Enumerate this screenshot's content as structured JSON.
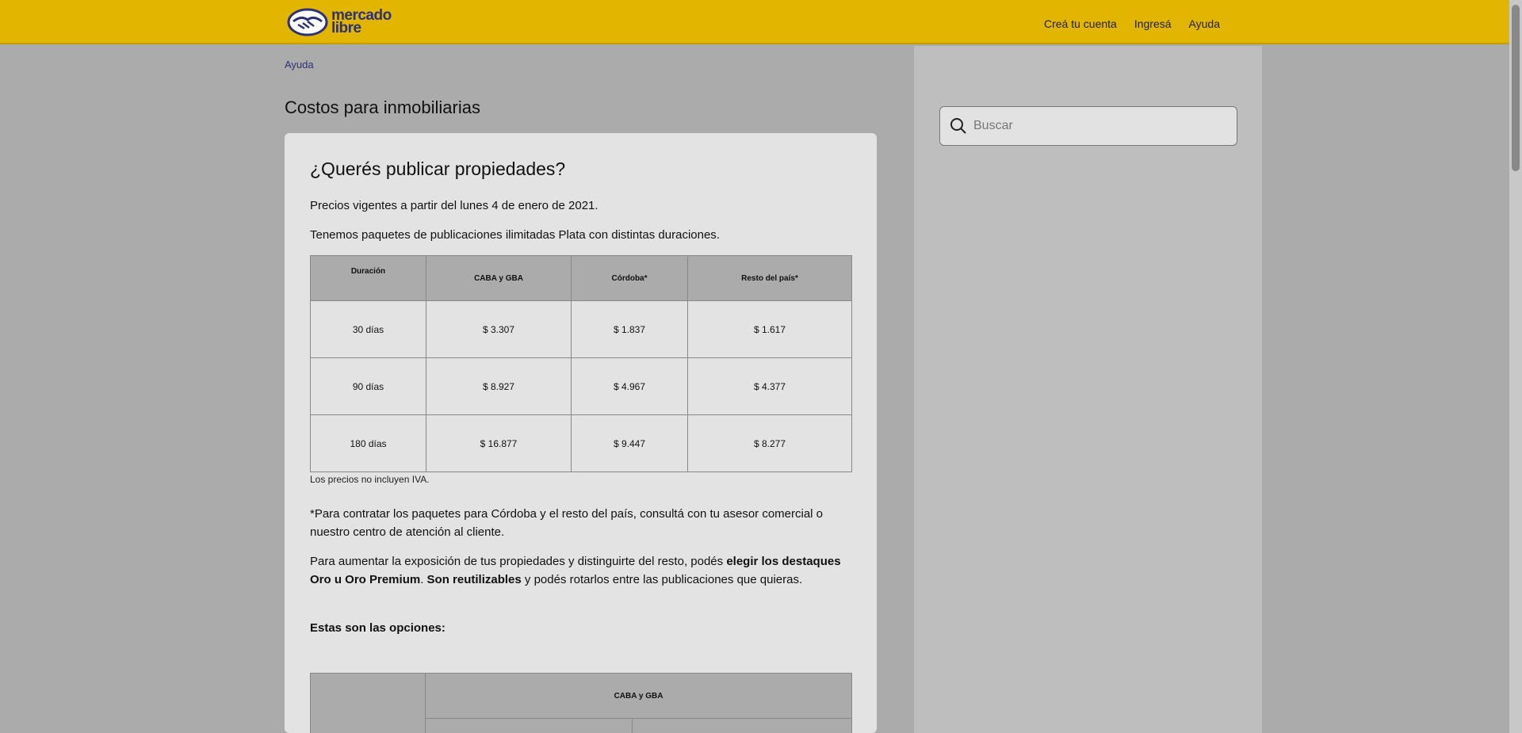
{
  "header": {
    "logo_text_line1": "mercado",
    "logo_text_line2": "libre",
    "nav": [
      "Creá tu cuenta",
      "Ingresá",
      "Ayuda"
    ]
  },
  "breadcrumb": "Ayuda",
  "page_title": "Costos para inmobiliarias",
  "search": {
    "placeholder": "Buscar"
  },
  "content": {
    "heading": "¿Querés publicar propiedades?",
    "p1": "Precios vigentes a partir del lunes 4 de enero de 2021.",
    "p2": "Tenemos paquetes de publicaciones ilimitadas Plata con distintas duraciones.",
    "table": {
      "headers": [
        "Duración",
        "CABA y GBA",
        "Córdoba*",
        "Resto del país*"
      ],
      "rows": [
        [
          "30 días",
          "$ 3.307",
          "$ 1.837",
          "$ 1.617"
        ],
        [
          "90 días",
          "$ 8.927",
          "$ 4.967",
          "$ 4.377"
        ],
        [
          "180 días",
          "$ 16.877",
          "$ 9.447",
          "$ 8.277"
        ]
      ]
    },
    "note": "Los precios no incluyen IVA.",
    "p3": "*Para contratar los paquetes para Córdoba y el resto del país, consultá con tu asesor comercial o nuestro centro de atención al cliente.",
    "p4_start": "Para aumentar la exposición de tus propiedades y distinguirte del resto, podés ",
    "p4_bold1": "elegir los destaques Oro u Oro Premium",
    "p4_mid": ". ",
    "p4_bold2": "Son reutilizables",
    "p4_end": " y podés rotarlos entre las publicaciones que quieras.",
    "p5": "Estas son las opciones:",
    "table2_header": "CABA y GBA"
  },
  "colors": {
    "header": "#e2b500",
    "brand_blue": "#2d3277"
  }
}
